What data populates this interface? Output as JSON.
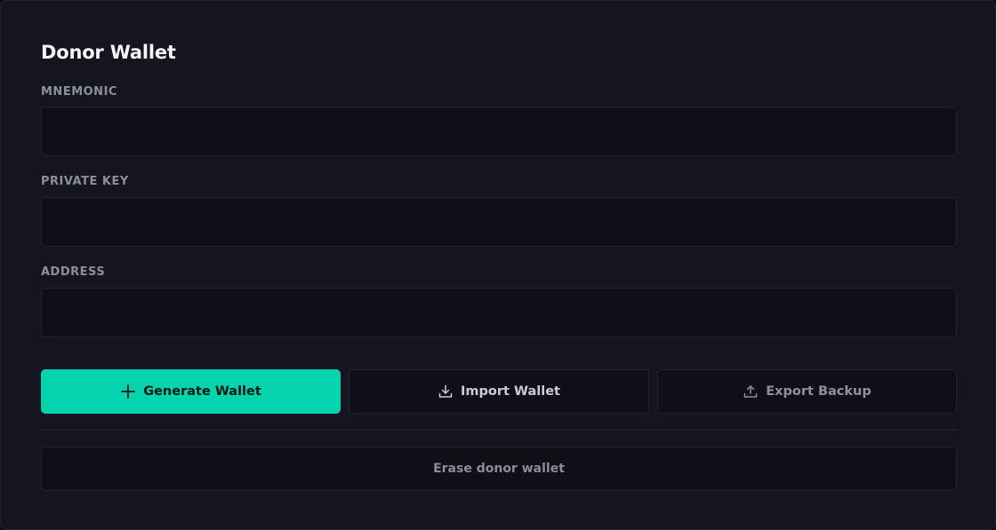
{
  "panel": {
    "title": "Donor Wallet"
  },
  "fields": {
    "mnemonic": {
      "label": "MNEMONIC",
      "value": "",
      "placeholder": ""
    },
    "private_key": {
      "label": "PRIVATE KEY",
      "value": "",
      "placeholder": ""
    },
    "address": {
      "label": "ADDRESS",
      "value": "",
      "placeholder": ""
    }
  },
  "actions": {
    "generate_label": "Generate Wallet",
    "generate_icon": "plus-icon",
    "import_label": "Import Wallet",
    "import_icon": "download-icon",
    "export_label": "Export Backup",
    "export_icon": "upload-icon",
    "erase_label": "Erase donor wallet"
  },
  "colors": {
    "background": "#14151e",
    "accent": "#03d4ae",
    "input_background": "#0f1017",
    "border": "#22242e",
    "title_text": "#f3f4f7",
    "label_text": "#8d8fa0"
  }
}
